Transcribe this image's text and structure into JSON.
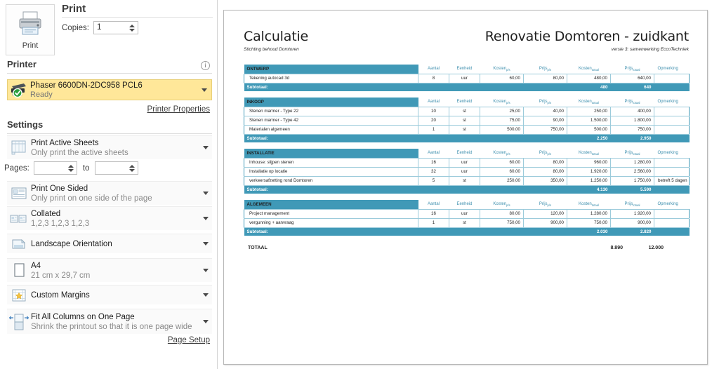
{
  "left_panel": {
    "print_button": {
      "label": "Print",
      "icon": "printer-icon"
    },
    "print_heading": "Print",
    "copies": {
      "label": "Copies:",
      "value": "1"
    },
    "printer_section": {
      "heading": "Printer",
      "info_icon": "info-icon",
      "selected": {
        "name": "Phaser 6600DN-2DC958 PCL6",
        "status": "Ready",
        "icon": "printer-ready-icon"
      },
      "properties_link": "Printer Properties"
    },
    "settings_section": {
      "heading": "Settings",
      "items": [
        {
          "main": "Print Active Sheets",
          "sub": "Only print the active sheets",
          "icon": "sheets-icon"
        },
        {
          "main": "Print One Sided",
          "sub": "Only print on one side of the page",
          "icon": "one-sided-icon"
        },
        {
          "main": "Collated",
          "sub": "1,2,3   1,2,3   1,2,3",
          "icon": "collated-icon"
        },
        {
          "main": "Landscape Orientation",
          "sub": "",
          "icon": "landscape-icon"
        },
        {
          "main": "A4",
          "sub": "21 cm x 29,7 cm",
          "icon": "paper-size-icon"
        },
        {
          "main": "Custom Margins",
          "sub": "",
          "icon": "margins-icon"
        },
        {
          "main": "Fit All Columns on One Page",
          "sub": "Shrink the printout so that it is one page wide",
          "icon": "scaling-icon"
        }
      ],
      "pages": {
        "label": "Pages:",
        "from_value": "",
        "to_label": "to",
        "to_value": ""
      }
    },
    "page_setup_link": "Page Setup"
  },
  "document": {
    "title": "Calculatie",
    "subtitle": "Stichting behoud Domtoren",
    "project_title": "Renovatie Domtoren - zuidkant",
    "project_version": "versie 3: samenwerking EccoTechniek",
    "columns": [
      "Aantal",
      "Eenheid",
      "Kosten",
      "Prijs",
      "Kosten",
      "Prijs",
      "Opmerking"
    ],
    "column_subs": [
      "",
      "",
      "p/s",
      "p/s",
      "totaal",
      "totaal",
      ""
    ],
    "subtotal_label": "Subtotaal:",
    "total_label": "TOTAAL",
    "total_costs": "8.890",
    "total_price": "12.000",
    "groups": [
      {
        "name": "ONTWERP",
        "rows": [
          {
            "name": "Tekening autocad 3d",
            "aantal": "8",
            "eenheid": "uur",
            "kosten_ps": "60,00",
            "prijs_ps": "80,00",
            "kosten_tot": "480,00",
            "prijs_tot": "640,00",
            "opmerking": ""
          }
        ],
        "subtotal_costs": "480",
        "subtotal_price": "640"
      },
      {
        "name": "INKOOP",
        "rows": [
          {
            "name": "Stenen marmer - Type 22",
            "aantal": "10",
            "eenheid": "st",
            "kosten_ps": "25,00",
            "prijs_ps": "40,00",
            "kosten_tot": "250,00",
            "prijs_tot": "400,00",
            "opmerking": ""
          },
          {
            "name": "Stenen marmer - Type 42",
            "aantal": "20",
            "eenheid": "st",
            "kosten_ps": "75,00",
            "prijs_ps": "90,00",
            "kosten_tot": "1.500,00",
            "prijs_tot": "1.800,00",
            "opmerking": ""
          },
          {
            "name": "Materialen algemeen",
            "aantal": "1",
            "eenheid": "st",
            "kosten_ps": "500,00",
            "prijs_ps": "750,00",
            "kosten_tot": "500,00",
            "prijs_tot": "750,00",
            "opmerking": ""
          }
        ],
        "subtotal_costs": "2.250",
        "subtotal_price": "2.950"
      },
      {
        "name": "INSTALLATIE",
        "rows": [
          {
            "name": "Inhouse: slijpen stenen",
            "aantal": "16",
            "eenheid": "uur",
            "kosten_ps": "60,00",
            "prijs_ps": "80,00",
            "kosten_tot": "960,00",
            "prijs_tot": "1.280,00",
            "opmerking": ""
          },
          {
            "name": "Installatie op locatie",
            "aantal": "32",
            "eenheid": "uur",
            "kosten_ps": "60,00",
            "prijs_ps": "80,00",
            "kosten_tot": "1.920,00",
            "prijs_tot": "2.560,00",
            "opmerking": ""
          },
          {
            "name": "verkeersafzetting rond Domtoren",
            "aantal": "5",
            "eenheid": "st",
            "kosten_ps": "250,00",
            "prijs_ps": "350,00",
            "kosten_tot": "1.250,00",
            "prijs_tot": "1.750,00",
            "opmerking": "betreft 5 dagen"
          }
        ],
        "subtotal_costs": "4.130",
        "subtotal_price": "5.590"
      },
      {
        "name": "ALGEMEEN",
        "rows": [
          {
            "name": "Project management",
            "aantal": "16",
            "eenheid": "uur",
            "kosten_ps": "80,00",
            "prijs_ps": "120,00",
            "kosten_tot": "1.280,00",
            "prijs_tot": "1.920,00",
            "opmerking": ""
          },
          {
            "name": "vergunning + aanvraag",
            "aantal": "1",
            "eenheid": "st",
            "kosten_ps": "750,00",
            "prijs_ps": "900,00",
            "kosten_tot": "750,00",
            "prijs_tot": "900,00",
            "opmerking": ""
          }
        ],
        "subtotal_costs": "2.030",
        "subtotal_price": "2.820"
      }
    ]
  },
  "colors": {
    "table_accent": "#4099b7",
    "table_border": "#9ccbdb",
    "printer_highlight": "#ffe799",
    "status_ok": "#2aa03c"
  }
}
